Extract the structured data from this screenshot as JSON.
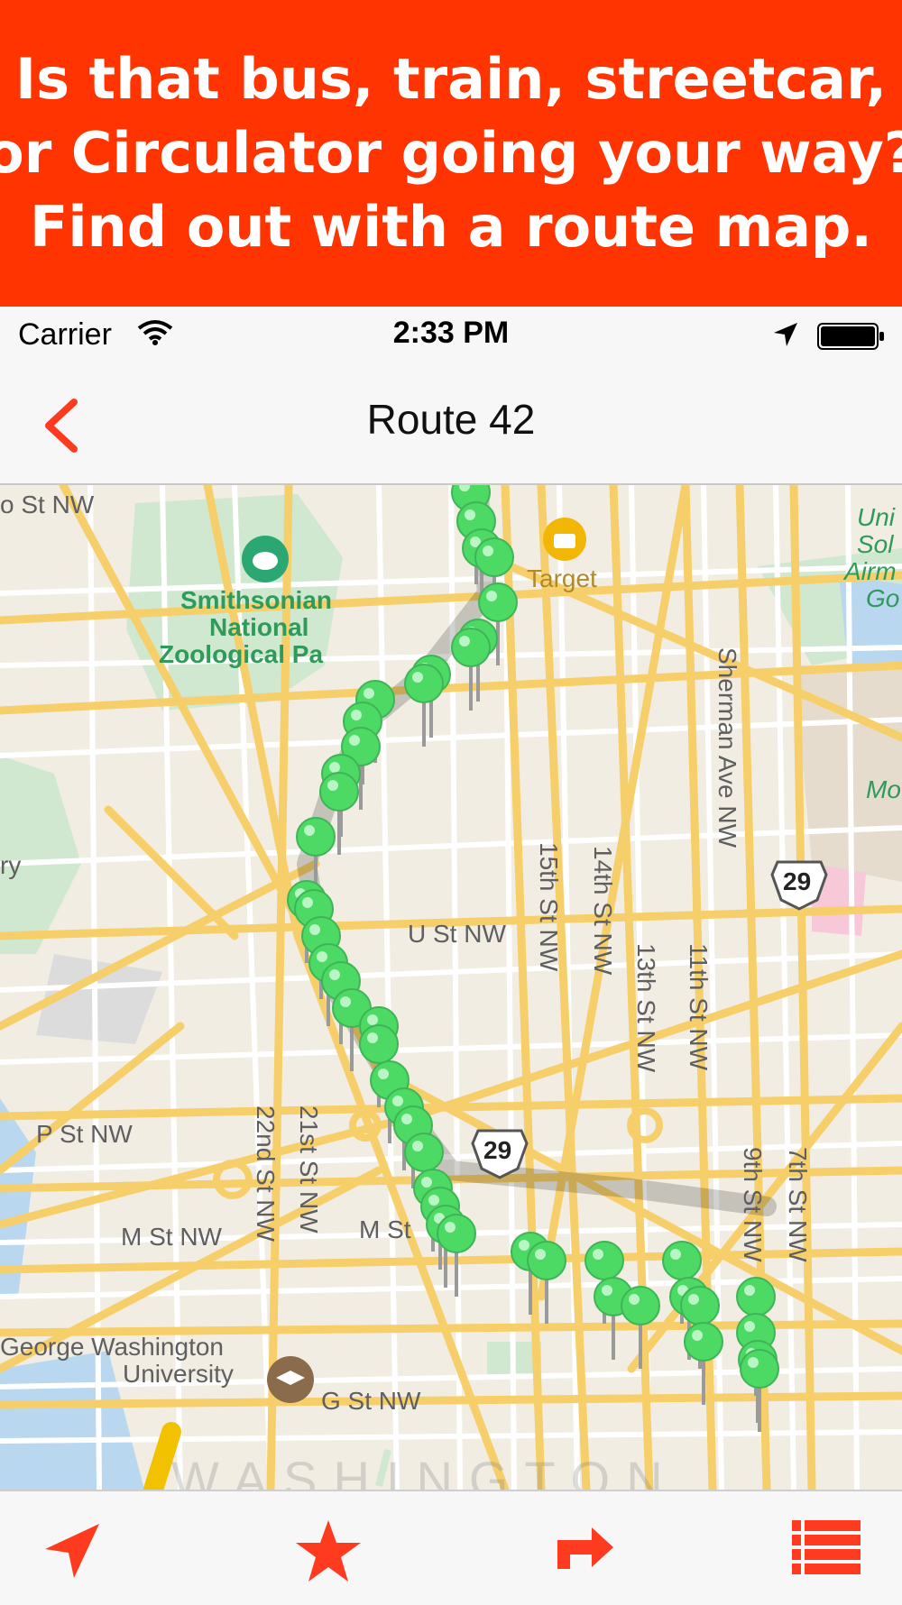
{
  "banner": {
    "lines": [
      "Is that bus, train, streetcar,",
      "or Circulator going your way?",
      "Find out with a route map."
    ],
    "background": "#ff3400"
  },
  "status_bar": {
    "carrier": "Carrier",
    "time": "2:33 PM",
    "icons": [
      "wifi-icon",
      "location-arrow-icon",
      "battery-icon"
    ]
  },
  "nav": {
    "title": "Route 42",
    "back_icon": "chevron-left-icon",
    "accent": "#ff3b1f"
  },
  "map": {
    "labels": {
      "top_left_street": "o St NW",
      "zoo_line1": "Smithsonian",
      "zoo_line2": "National",
      "zoo_line3": "Zoological Pa",
      "target": "Target",
      "u_st": "U St NW",
      "p_st": "P St NW",
      "m_st_left": "M St NW",
      "m_st_mid": "M St",
      "g_st": "G St NW",
      "gwu_line1": "George Washington",
      "gwu_line2": "University",
      "ry": "ry",
      "st15": "15th St NW",
      "st14": "14th St NW",
      "st13": "13th St NW",
      "st11": "11th St NW",
      "st9": "9th St NW",
      "st7": "7th St NW",
      "st22": "22nd St NW",
      "st21": "21st St NW",
      "sherman": "Sherman Ave NW",
      "right_uni1": "Uni",
      "right_uni2": "Sol",
      "right_uni3": "Airm",
      "right_uni4": "Go",
      "right_mo": "Mo",
      "washington": "WASHINGTON"
    },
    "shields": [
      "29",
      "29"
    ],
    "stop_pin_color": "#4cd964",
    "route_stop_count": 44
  },
  "tabbar": {
    "items": [
      "location-arrow-icon",
      "star-icon",
      "directions-icon",
      "list-icon"
    ],
    "color": "#ff3b1f"
  }
}
